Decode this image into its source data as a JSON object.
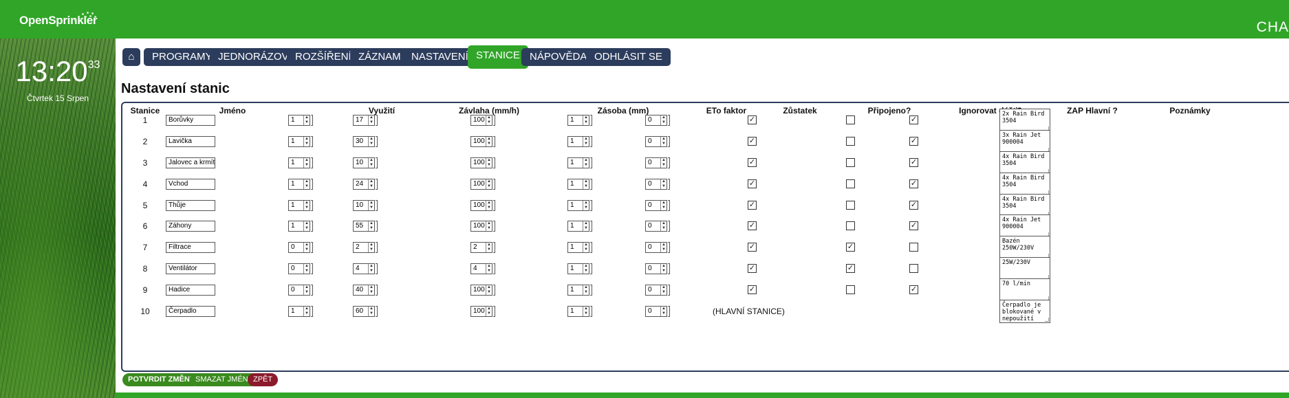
{
  "app": {
    "logo": "OpenSprinkler",
    "top_right_text": "CHA"
  },
  "sidebar": {
    "clock": "13:20",
    "seconds": "33",
    "date": "Čtvrtek 15 Srpen"
  },
  "nav": {
    "home_label": "⌂",
    "items": [
      "PROGRAMY",
      "JEDNORÁZOVÝ",
      "ROZŠÍŘENÍ",
      "ZÁZNAM",
      "NASTAVENÍ",
      "STANICE",
      "NÁPOVĚDA",
      "ODHLÁSIT SE"
    ],
    "active": "STANICE"
  },
  "page_title": "Nastavení stanic",
  "table": {
    "headers": [
      "Stanice",
      "Jméno",
      "Využití",
      "Závlaha (mm/h)",
      "Zásoba (mm)",
      "ETo faktor",
      "Zůstatek",
      "Připojeno?",
      "Ignorovat déšť?",
      "ZAP Hlavní ?",
      "Poznámky"
    ],
    "rows": [
      {
        "id": "1",
        "name": "Borůvky",
        "usage": "1",
        "irrigation": "17",
        "reserve": "100",
        "eto": "1",
        "remainder": "0",
        "connected": true,
        "ignore_rain": false,
        "master": true,
        "note": "2x Rain Bird\n3504"
      },
      {
        "id": "2",
        "name": "Lavička",
        "usage": "1",
        "irrigation": "30",
        "reserve": "100",
        "eto": "1",
        "remainder": "0",
        "connected": true,
        "ignore_rain": false,
        "master": true,
        "note": "3x Rain Jet\n900004"
      },
      {
        "id": "3",
        "name": "Jalovec a krmítko",
        "usage": "1",
        "irrigation": "10",
        "reserve": "100",
        "eto": "1",
        "remainder": "0",
        "connected": true,
        "ignore_rain": false,
        "master": true,
        "note": "4x Rain Bird\n3504"
      },
      {
        "id": "4",
        "name": "Vchod",
        "usage": "1",
        "irrigation": "24",
        "reserve": "100",
        "eto": "1",
        "remainder": "0",
        "connected": true,
        "ignore_rain": false,
        "master": true,
        "note": "4x Rain Bird\n3504"
      },
      {
        "id": "5",
        "name": "Thůje",
        "usage": "1",
        "irrigation": "10",
        "reserve": "100",
        "eto": "1",
        "remainder": "0",
        "connected": true,
        "ignore_rain": false,
        "master": true,
        "note": "4x Rain Bird\n3504"
      },
      {
        "id": "6",
        "name": "Záhony",
        "usage": "1",
        "irrigation": "55",
        "reserve": "100",
        "eto": "1",
        "remainder": "0",
        "connected": true,
        "ignore_rain": false,
        "master": true,
        "note": "4x Rain Jet\n900004"
      },
      {
        "id": "7",
        "name": "Filtrace",
        "usage": "0",
        "irrigation": "2",
        "reserve": "2",
        "eto": "1",
        "remainder": "0",
        "connected": true,
        "ignore_rain": true,
        "master": false,
        "note": "Bazén\n250W/230V"
      },
      {
        "id": "8",
        "name": "Ventilátor",
        "usage": "0",
        "irrigation": "4",
        "reserve": "4",
        "eto": "1",
        "remainder": "0",
        "connected": true,
        "ignore_rain": true,
        "master": false,
        "note": "25W/230V"
      },
      {
        "id": "9",
        "name": "Hadice",
        "usage": "0",
        "irrigation": "40",
        "reserve": "100",
        "eto": "1",
        "remainder": "0",
        "connected": true,
        "ignore_rain": false,
        "master": true,
        "note": "70 l/min"
      },
      {
        "id": "10",
        "name": "Čerpadlo",
        "usage": "1",
        "irrigation": "60",
        "reserve": "100",
        "eto": "1",
        "remainder": "0",
        "master_station_label": "(HLAVNÍ STANICE)",
        "note": "Čerpadlo je\nblokované v\nnepoužití"
      }
    ]
  },
  "actions": {
    "confirm": "POTVRDIT ZMĚNY",
    "clear_names": "SMAZAT JMÉNA",
    "back": "ZPĚT"
  },
  "colors": {
    "brand_green": "#30a528",
    "nav_blue": "#2c3c5c",
    "back_red": "#8b1a2b",
    "action_green": "#3a8a1e"
  }
}
